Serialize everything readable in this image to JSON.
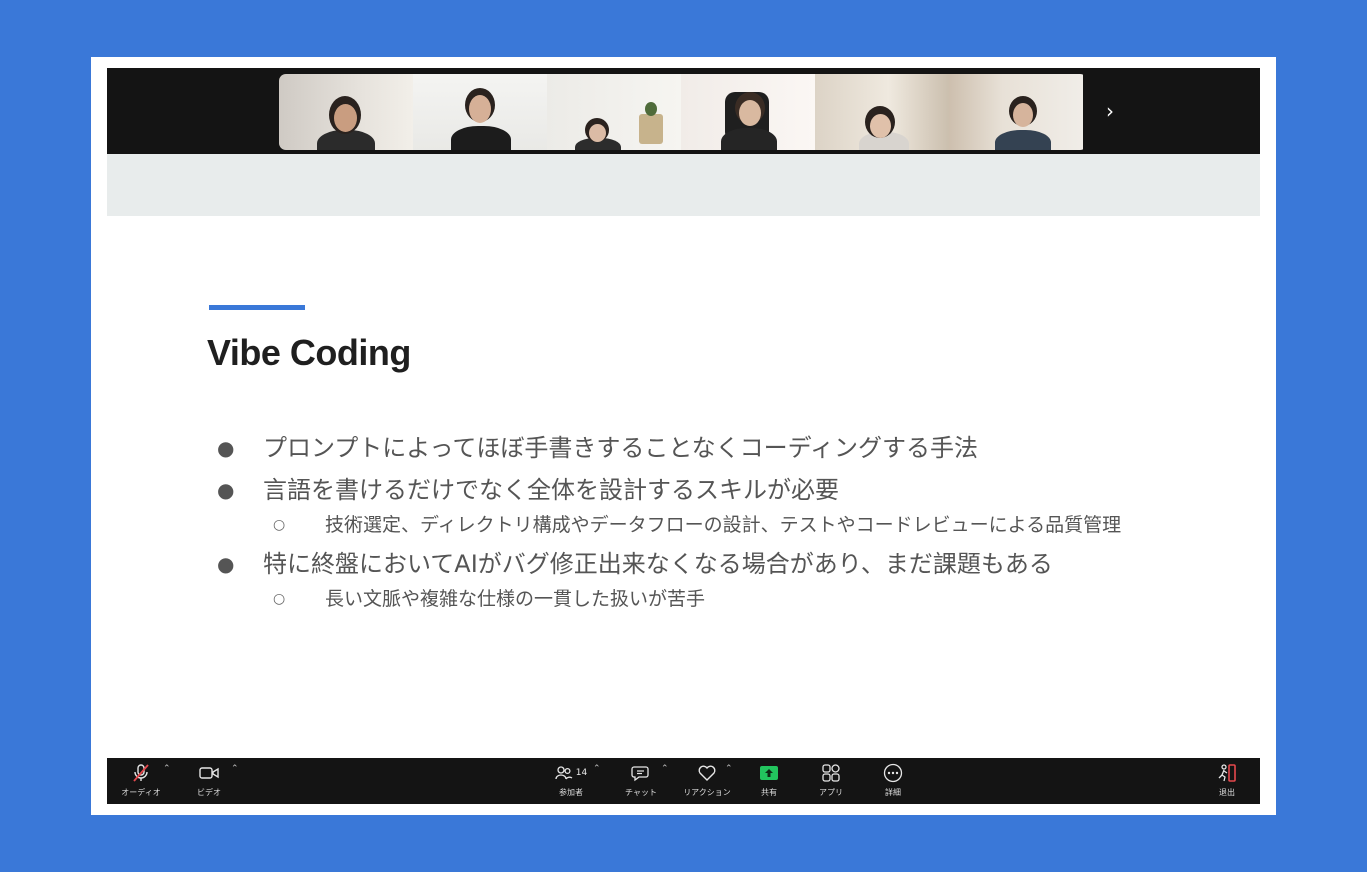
{
  "gallery": {
    "next_label": "›"
  },
  "slide": {
    "title": "Vibe Coding",
    "bullets": [
      {
        "level": 1,
        "text": "プロンプトによってほぼ手書きすることなくコーディングする手法"
      },
      {
        "level": 1,
        "text": "言語を書けるだけでなく全体を設計するスキルが必要"
      },
      {
        "level": 2,
        "text": "技術選定、ディレクトリ構成やデータフローの設計、テストやコードレビューによる品質管理"
      },
      {
        "level": 1,
        "text": "特に終盤においてAIがバグ修正出来なくなる場合があり、まだ課題もある"
      },
      {
        "level": 2,
        "text": "長い文脈や複雑な仕様の一貫した扱いが苦手"
      }
    ],
    "bullet_glyph": "●",
    "sub_bullet_glyph": "○"
  },
  "toolbar": {
    "audio_label": "オーディオ",
    "video_label": "ビデオ",
    "participants_label": "参加者",
    "participants_count": "14",
    "chat_label": "チャット",
    "reactions_label": "リアクション",
    "share_label": "共有",
    "apps_label": "アプリ",
    "more_label": "詳細",
    "leave_label": "退出",
    "caret": "⌃"
  },
  "colors": {
    "background": "#3a78d8",
    "accent": "#3a78d8",
    "share_green": "#22c55e",
    "mute_red": "#e5484d",
    "active_speaker": "#2fb340"
  }
}
